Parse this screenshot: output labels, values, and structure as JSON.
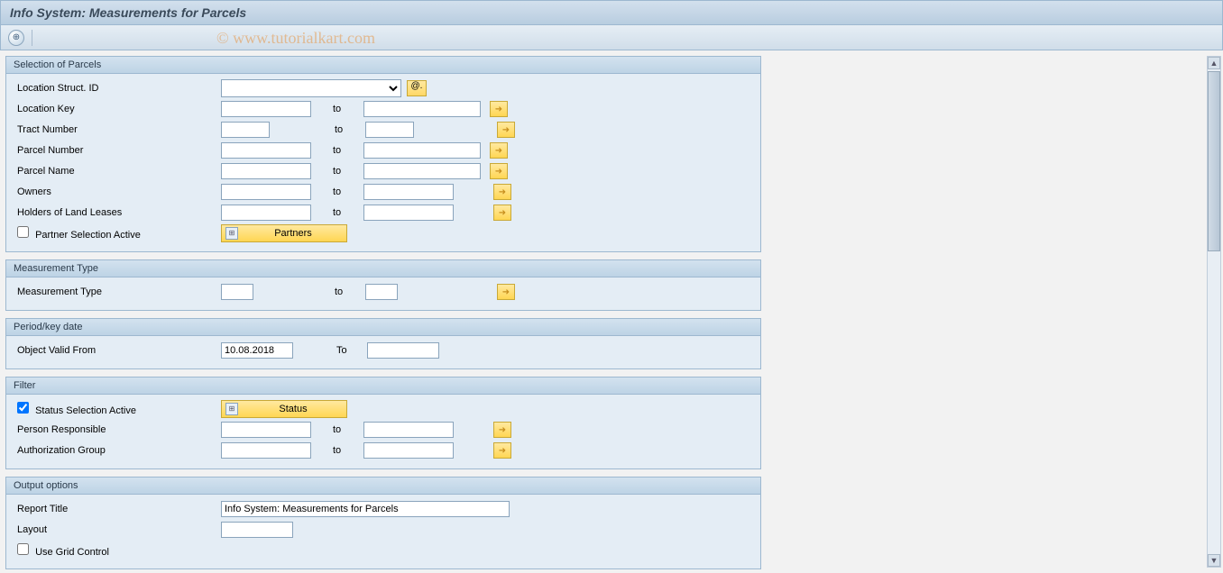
{
  "title": "Info System: Measurements for Parcels",
  "watermark": "© www.tutorialkart.com",
  "toolbar": {
    "execute_icon": "⊕"
  },
  "groups": {
    "parcels": {
      "header": "Selection of Parcels",
      "location_struct_id_label": "Location Struct. ID",
      "location_struct_id_value": "",
      "search_label": "@.",
      "location_key_label": "Location Key",
      "tract_number_label": "Tract Number",
      "parcel_number_label": "Parcel Number",
      "parcel_name_label": "Parcel Name",
      "owners_label": "Owners",
      "holders_label": "Holders of Land Leases",
      "to_label": "to",
      "partner_sel_active_label": "Partner Selection Active",
      "partner_sel_active_checked": false,
      "partners_button": "Partners"
    },
    "meas": {
      "header": "Measurement Type",
      "measurement_type_label": "Measurement Type",
      "to_label": "to"
    },
    "period": {
      "header": "Period/key date",
      "valid_from_label": "Object Valid From",
      "valid_from_value": "10.08.2018",
      "to_label": "To",
      "to_value": ""
    },
    "filter": {
      "header": "Filter",
      "status_sel_active_label": "Status Selection Active",
      "status_sel_active_checked": true,
      "status_button": "Status",
      "person_resp_label": "Person Responsible",
      "auth_group_label": "Authorization Group",
      "to_label": "to"
    },
    "output": {
      "header": "Output options",
      "report_title_label": "Report Title",
      "report_title_value": "Info System: Measurements for Parcels",
      "layout_label": "Layout",
      "layout_value": "",
      "grid_control_label": "Use Grid Control",
      "grid_control_checked": false
    }
  }
}
